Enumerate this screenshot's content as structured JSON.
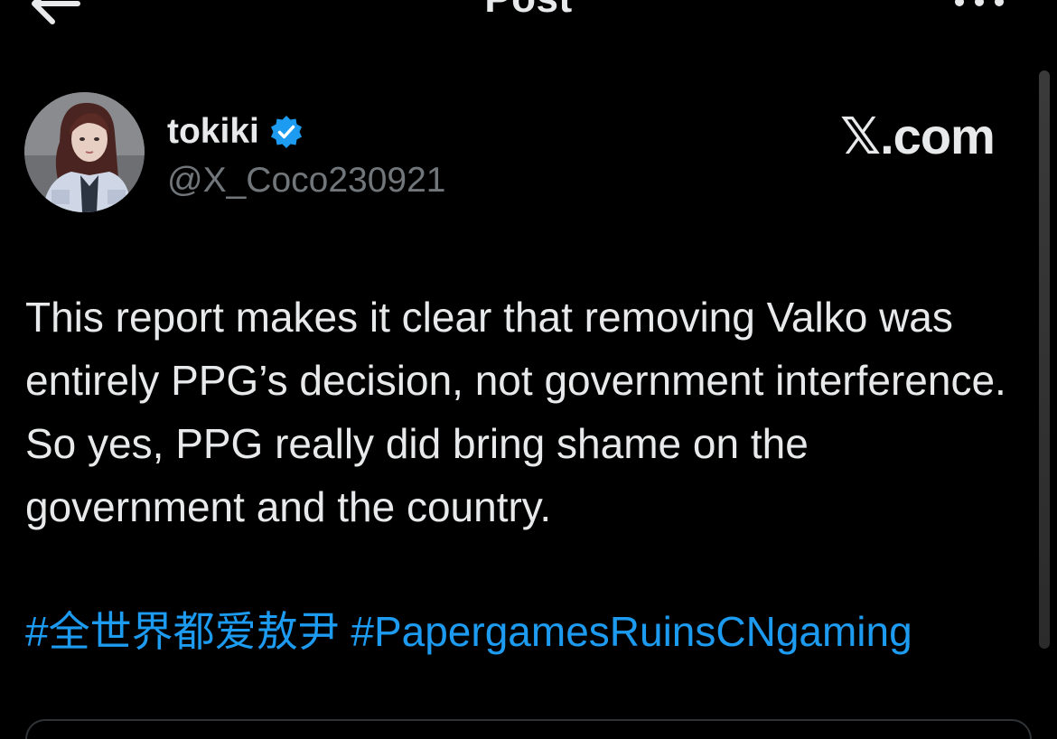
{
  "header": {
    "title": "Post",
    "back_icon": "arrow-left-icon",
    "more_icon": "ellipsis-icon"
  },
  "author": {
    "display_name": "tokiki",
    "handle": "@X_Coco230921",
    "verified_icon": "verified-badge-icon",
    "verified_color": "#1d9bf0"
  },
  "brand": {
    "text": "𝕏.com"
  },
  "post": {
    "text": "This report makes it clear that removing Valko was entirely PPG’s decision, not government interference. So yes, PPG really did bring shame on the government and the country.",
    "hashtags": [
      "#全世界都爱敖尹",
      "#PapergamesRuinsCNgaming"
    ],
    "hashtag_color": "#1d9bf0"
  },
  "colors": {
    "background": "#000000",
    "text_primary": "#e7e9ea",
    "text_secondary": "#71767b",
    "accent": "#1d9bf0"
  }
}
